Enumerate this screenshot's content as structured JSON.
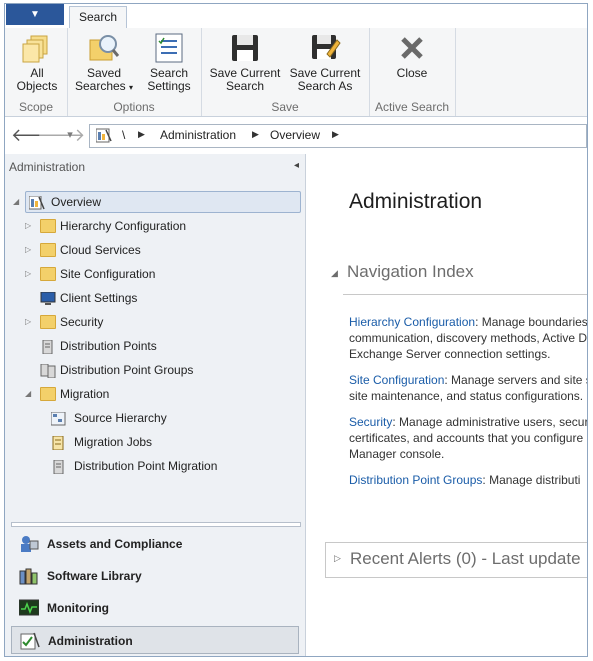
{
  "ribbon": {
    "app_menu_arrow": "▼",
    "active_tab": "Search",
    "groups": {
      "scope": {
        "label": "Scope",
        "all_objects": "All\nObjects"
      },
      "options": {
        "label": "Options",
        "saved_searches_1": "Saved",
        "saved_searches_2": "Searches",
        "search_settings_1": "Search",
        "search_settings_2": "Settings"
      },
      "save": {
        "label": "Save",
        "save_current_1": "Save Current",
        "save_current_2": "Search",
        "save_as_1": "Save Current",
        "save_as_2": "Search As"
      },
      "active_search": {
        "label": "Active Search",
        "close": "Close"
      }
    }
  },
  "address_bar": {
    "back": "🡐",
    "forward": "🡒",
    "dropdown": "▾",
    "root": "\\",
    "crumbs": [
      "Administration",
      "Overview"
    ]
  },
  "left_pane": {
    "title": "Administration",
    "collapse": "◂",
    "tree": [
      {
        "label": "Overview"
      },
      {
        "label": "Hierarchy Configuration"
      },
      {
        "label": "Cloud Services"
      },
      {
        "label": "Site Configuration"
      },
      {
        "label": "Client Settings"
      },
      {
        "label": "Security"
      },
      {
        "label": "Distribution Points"
      },
      {
        "label": "Distribution Point Groups"
      },
      {
        "label": "Migration"
      },
      {
        "label": "Source Hierarchy"
      },
      {
        "label": "Migration Jobs"
      },
      {
        "label": "Distribution Point Migration"
      }
    ],
    "workspaces": [
      {
        "label": "Assets and Compliance"
      },
      {
        "label": "Software Library"
      },
      {
        "label": "Monitoring"
      },
      {
        "label": "Administration"
      }
    ]
  },
  "main": {
    "title": "Administration",
    "nav_index_heading": "Navigation Index",
    "items": [
      {
        "link": "Hierarchy Configuration",
        "line1": ": Manage boundaries",
        "line2": "communication, discovery methods, Active Di",
        "line3": "Exchange Server connection settings."
      },
      {
        "link": "Site Configuration",
        "line1": ": Manage servers and site s",
        "line2": "site maintenance, and status configurations.",
        "line3": ""
      },
      {
        "link": "Security",
        "line1": ": Manage administrative users, securi",
        "line2": "certificates, and accounts that you configure i",
        "line3": "Manager console."
      },
      {
        "link": "Distribution Point Groups",
        "line1": ": Manage distributi",
        "line2": "",
        "line3": ""
      }
    ],
    "alerts_heading": "Recent Alerts (0) - Last update"
  },
  "colors": {
    "accent": "#2b579a",
    "link": "#1a5ca8",
    "folder": "#f3d06a"
  }
}
